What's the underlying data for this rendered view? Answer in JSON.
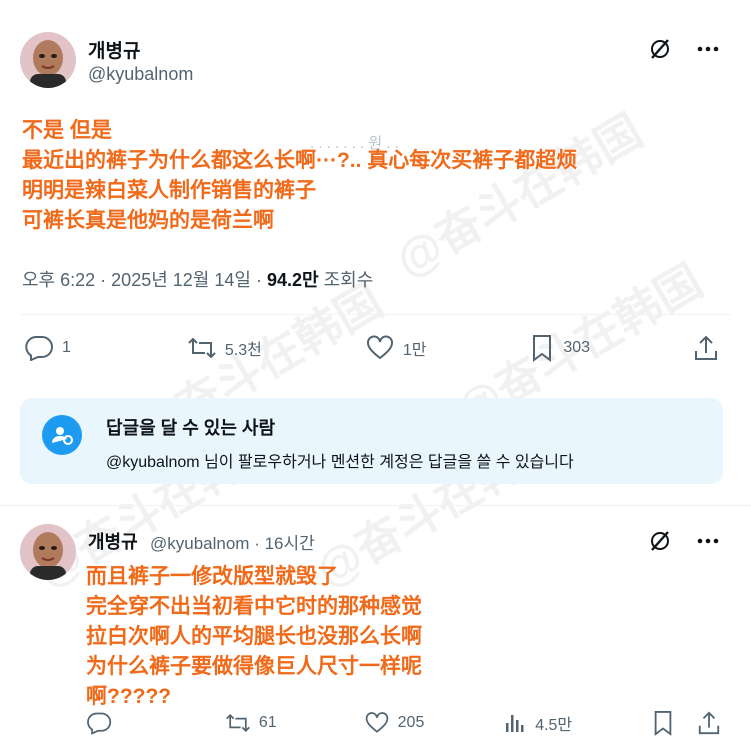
{
  "post": {
    "display_name": "개병규",
    "handle": "@kyubalnom",
    "overlay_lines": [
      "不是 但是",
      "最近出的裤子为什么都这么长啊···?.. 真心每次买裤子都超烦",
      "明明是辣白菜人制作销售的裤子",
      "可裤长真是他妈的是荷兰啊"
    ],
    "meta": {
      "time": "오후 6:22",
      "date": "2025년 12월 14일",
      "views": "94.2만",
      "views_label": "조회수"
    },
    "actions": {
      "replies": "1",
      "reposts": "5.3천",
      "likes": "1만",
      "bookmarks": "303"
    },
    "reply_restriction": {
      "title": "답글을 달 수 있는 사람",
      "subtitle": "@kyubalnom 님이 팔로우하거나 멘션한 계정은 답글을 쓸 수 있습니다"
    }
  },
  "reply": {
    "display_name": "개병규",
    "handle_time": "@kyubalnom · 16시간",
    "overlay_lines": [
      "而且裤子一修改版型就毁了",
      "完全穿不出当初看中它时的那种感觉",
      "拉白次啊人的平均腿长也没那么长啊",
      "为什么裤子要做得像巨人尺寸一样呢",
      "啊?????"
    ],
    "actions": {
      "reposts": "61",
      "likes": "205",
      "views": "4.5만"
    }
  },
  "watermark": "@奋斗在韩国",
  "colors": {
    "overlay": "#f06a1a",
    "accent": "#1d9bf0",
    "muted": "#536471",
    "reply_box_bg": "#eaf6fe"
  },
  "icons": {
    "grok": "grok-icon",
    "more": "more-icon",
    "reply": "reply-icon",
    "repost": "repost-icon",
    "like": "like-icon",
    "bookmark": "bookmark-icon",
    "share": "share-icon",
    "views": "views-icon",
    "mention": "mention-person-icon"
  }
}
